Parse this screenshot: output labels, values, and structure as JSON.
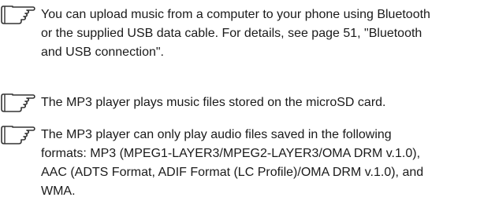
{
  "notes": [
    {
      "icon": "pointing-hand-icon",
      "text": "You can upload music from a computer to your phone using Bluetooth\nor the supplied USB data cable. For details, see page 51, \"Bluetooth\nand USB connection\"."
    },
    {
      "icon": "pointing-hand-icon",
      "text": "The MP3 player plays music files stored on the microSD card."
    },
    {
      "icon": "pointing-hand-icon",
      "text": "The MP3 player can only play audio files saved in the following\nformats: MP3 (MPEG1-LAYER3/MPEG2-LAYER3/OMA DRM v.1.0),\nAAC (ADTS Format, ADIF Format (LC Profile)/OMA DRM v.1.0), and\nWMA."
    }
  ]
}
